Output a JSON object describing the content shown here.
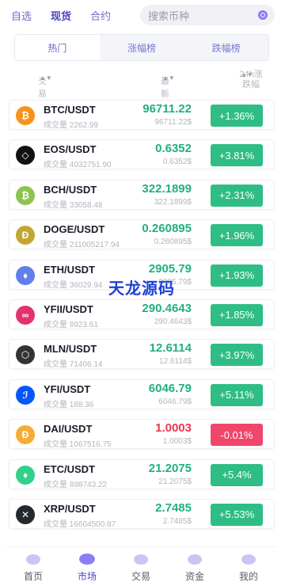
{
  "top_nav": [
    {
      "label": "自选",
      "active": false
    },
    {
      "label": "现货",
      "active": true
    },
    {
      "label": "合约",
      "active": false
    }
  ],
  "search": {
    "placeholder": "搜索币种"
  },
  "tabs": [
    {
      "label": "热门",
      "active": true
    },
    {
      "label": "涨幅榜",
      "active": false
    },
    {
      "label": "跌幅榜",
      "active": false
    }
  ],
  "columns": {
    "pair": "交易对",
    "price": "最新价",
    "change": "24h涨跌幅"
  },
  "markets": [
    {
      "pair": "BTC/USDT",
      "volume_label": "成交量",
      "volume": "2262.99",
      "price": "96711.22",
      "price_sub": "96711.22$",
      "change": "+1.36%",
      "direction": "up",
      "icon": "bitcoin-icon",
      "icon_color": "#f7931a",
      "glyph": "₿"
    },
    {
      "pair": "EOS/USDT",
      "volume_label": "成交量",
      "volume": "4032751.90",
      "price": "0.6352",
      "price_sub": "0.6352$",
      "change": "+3.81%",
      "direction": "up",
      "icon": "eos-icon",
      "icon_color": "#111111",
      "glyph": "◇"
    },
    {
      "pair": "BCH/USDT",
      "volume_label": "成交量",
      "volume": "33058.48",
      "price": "322.1899",
      "price_sub": "322.1899$",
      "change": "+2.31%",
      "direction": "up",
      "icon": "bitcoin-cash-icon",
      "icon_color": "#8dc351",
      "glyph": "₿"
    },
    {
      "pair": "DOGE/USDT",
      "volume_label": "成交量",
      "volume": "211005217.94",
      "price": "0.260895",
      "price_sub": "0.260895$",
      "change": "+1.96%",
      "direction": "up",
      "icon": "dogecoin-icon",
      "icon_color": "#c2a633",
      "glyph": "Ð"
    },
    {
      "pair": "ETH/USDT",
      "volume_label": "成交量",
      "volume": "36029.94",
      "price": "2905.79",
      "price_sub": "2905.79$",
      "change": "+1.93%",
      "direction": "up",
      "icon": "ethereum-icon",
      "icon_color": "#627eea",
      "glyph": "♦"
    },
    {
      "pair": "YFII/USDT",
      "volume_label": "成交量",
      "volume": "8923.61",
      "price": "290.4643",
      "price_sub": "290.4643$",
      "change": "+1.85%",
      "direction": "up",
      "icon": "yfii-icon",
      "icon_color": "#e4316f",
      "glyph": "∞"
    },
    {
      "pair": "MLN/USDT",
      "volume_label": "成交量",
      "volume": "71406.14",
      "price": "12.6114",
      "price_sub": "12.6114$",
      "change": "+3.97%",
      "direction": "up",
      "icon": "melon-icon",
      "icon_color": "#333333",
      "glyph": "⬡"
    },
    {
      "pair": "YFI/USDT",
      "volume_label": "成交量",
      "volume": "188.36",
      "price": "6046.79",
      "price_sub": "6046.79$",
      "change": "+5.11%",
      "direction": "up",
      "icon": "yfi-icon",
      "icon_color": "#0657f9",
      "glyph": "ℐ"
    },
    {
      "pair": "DAI/USDT",
      "volume_label": "成交量",
      "volume": "1067516.75",
      "price": "1.0003",
      "price_sub": "1.0003$",
      "change": "-0.01%",
      "direction": "down",
      "icon": "dai-icon",
      "icon_color": "#f5ac37",
      "glyph": "Đ"
    },
    {
      "pair": "ETC/USDT",
      "volume_label": "成交量",
      "volume": "898743.22",
      "price": "21.2075",
      "price_sub": "21.2075$",
      "change": "+5.4%",
      "direction": "up",
      "icon": "ethereum-classic-icon",
      "icon_color": "#33d08b",
      "glyph": "♦"
    },
    {
      "pair": "XRP/USDT",
      "volume_label": "成交量",
      "volume": "16604500.87",
      "price": "2.7485",
      "price_sub": "2.7485$",
      "change": "+5.53%",
      "direction": "up",
      "icon": "xrp-icon",
      "icon_color": "#23292f",
      "glyph": "✕"
    }
  ],
  "watermark": "天龙源码",
  "bottom_nav": [
    {
      "label": "首页",
      "icon": "home-icon",
      "active": false
    },
    {
      "label": "市场",
      "icon": "market-icon",
      "active": true
    },
    {
      "label": "交易",
      "icon": "trade-icon",
      "active": false
    },
    {
      "label": "资金",
      "icon": "wallet-icon",
      "active": false
    },
    {
      "label": "我的",
      "icon": "profile-icon",
      "active": false
    }
  ],
  "colors": {
    "up": "#2ebd85",
    "down": "#f0466a",
    "accent": "#4b45c3"
  }
}
